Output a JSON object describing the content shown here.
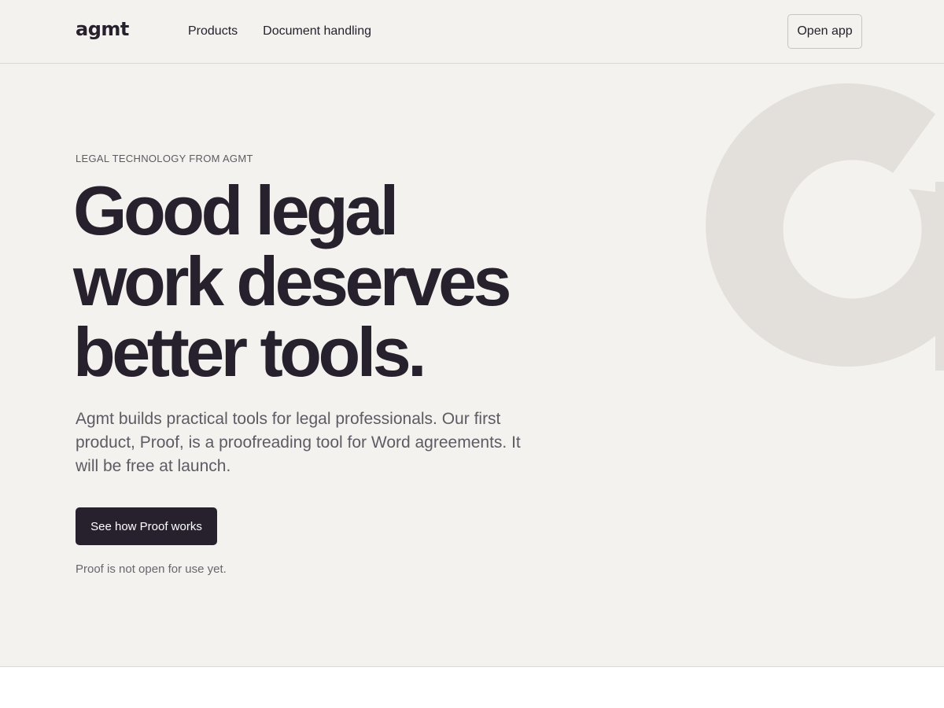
{
  "header": {
    "logo_text": "agmt",
    "nav": [
      {
        "label": "Products"
      },
      {
        "label": "Document handling"
      }
    ],
    "open_app_label": "Open app"
  },
  "hero": {
    "eyebrow": "LEGAL TECHNOLOGY FROM AGMT",
    "title_lines": [
      "Good legal",
      "work deserves",
      "better tools."
    ],
    "body": "Agmt builds practical tools for legal professionals. Our first product, Proof, is a proofreading tool for Word agreements. It will be free at launch.",
    "cta_label": "See how Proof works",
    "cta_note": "Proof is not open for use yet.",
    "decorative_mark": "agmt-ring-mark-icon"
  },
  "colors": {
    "page_bg": "#f4f2ee",
    "ink": "#27212e",
    "muted_text": "#5f5a63",
    "mark": "#e3e0dc",
    "below_bg": "#ffffff"
  }
}
